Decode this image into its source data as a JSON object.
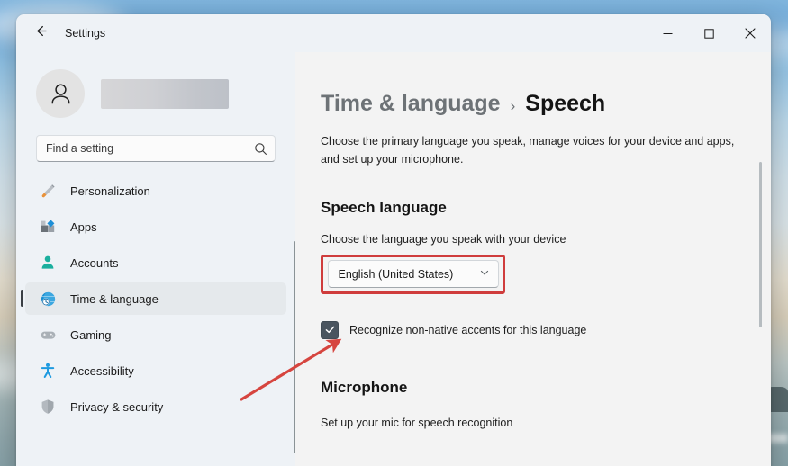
{
  "window": {
    "app_title": "Settings",
    "back_icon": "back-arrow-icon",
    "minimize_label": "–",
    "maximize_label": "□",
    "close_label": "✕"
  },
  "sidebar": {
    "account_name_redacted": "",
    "search": {
      "placeholder": "Find a setting",
      "value": "",
      "icon": "search-icon"
    },
    "items": [
      {
        "label": "Personalization",
        "icon": "paintbrush-icon",
        "selected": false
      },
      {
        "label": "Apps",
        "icon": "apps-icon",
        "selected": false
      },
      {
        "label": "Accounts",
        "icon": "person-icon",
        "selected": false
      },
      {
        "label": "Time & language",
        "icon": "globe-clock-icon",
        "selected": true
      },
      {
        "label": "Gaming",
        "icon": "gamepad-icon",
        "selected": false
      },
      {
        "label": "Accessibility",
        "icon": "accessibility-icon",
        "selected": false
      },
      {
        "label": "Privacy & security",
        "icon": "shield-icon",
        "selected": false
      }
    ]
  },
  "content": {
    "breadcrumb": {
      "parent": "Time & language",
      "separator": "›",
      "current": "Speech"
    },
    "description": "Choose the primary language you speak, manage voices for your device and apps, and set up your microphone.",
    "speech_language": {
      "heading": "Speech language",
      "field_label": "Choose the language you speak with your device",
      "dropdown_value": "English (United States)",
      "dropdown_icon": "chevron-down-icon",
      "checkbox_label": "Recognize non-native accents for this language",
      "checkbox_checked": true
    },
    "microphone": {
      "heading": "Microphone",
      "description": "Set up your mic for speech recognition"
    }
  },
  "annotations": {
    "highlight_color": "#cf3c3c",
    "arrow_color": "#d6453f",
    "highlight_target": "language-dropdown",
    "arrow_target": "accent-checkbox"
  }
}
